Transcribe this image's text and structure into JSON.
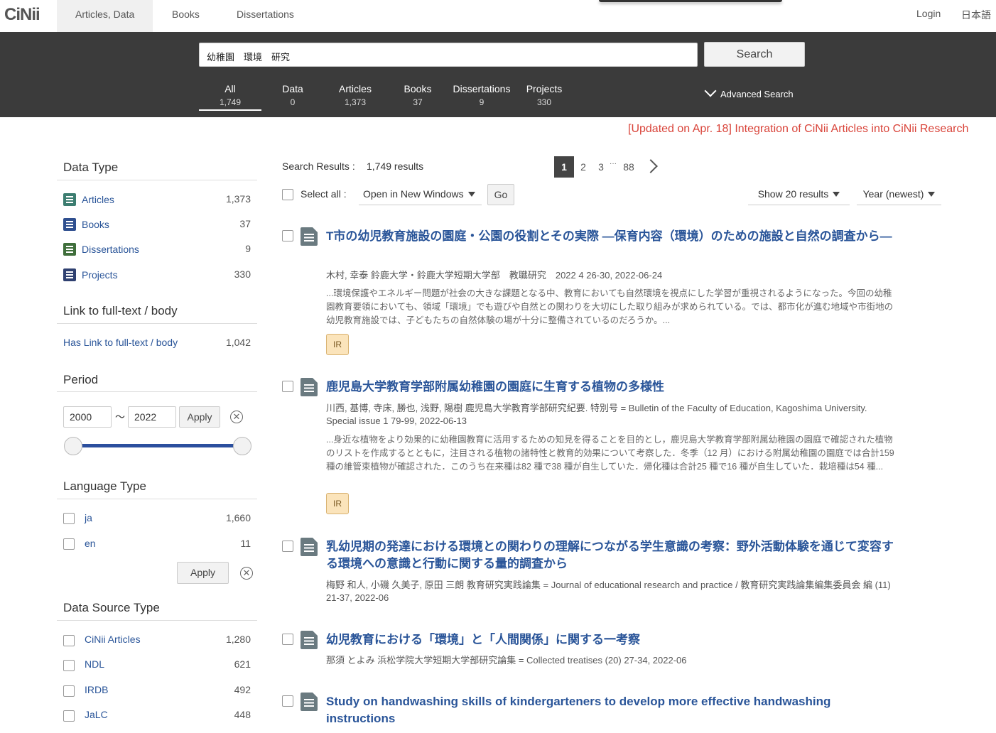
{
  "header": {
    "logo": "CiNii",
    "tabs": [
      "Articles, Data",
      "Books",
      "Dissertations"
    ],
    "login": "Login",
    "lang": "日本語"
  },
  "search": {
    "query": "幼稚園　環境　研究",
    "button": "Search",
    "advanced": "Advanced Search",
    "tabs": [
      {
        "label": "All",
        "count": "1,749"
      },
      {
        "label": "Data",
        "count": "0"
      },
      {
        "label": "Articles",
        "count": "1,373"
      },
      {
        "label": "Books",
        "count": "37"
      },
      {
        "label": "Dissertations",
        "count": "9"
      },
      {
        "label": "Projects",
        "count": "330"
      }
    ]
  },
  "notice": "[Updated on Apr. 18] Integration of CiNii Articles into CiNii Research",
  "sidebar": {
    "data_type": {
      "heading": "Data Type",
      "items": [
        {
          "label": "Articles",
          "count": "1,373",
          "icon": "article-icon"
        },
        {
          "label": "Books",
          "count": "37",
          "icon": "book-icon"
        },
        {
          "label": "Dissertations",
          "count": "9",
          "icon": "dissertation-icon"
        },
        {
          "label": "Projects",
          "count": "330",
          "icon": "project-icon"
        }
      ]
    },
    "fulltext": {
      "heading": "Link to full-text / body",
      "items": [
        {
          "label": "Has Link to full-text / body",
          "count": "1,042"
        }
      ]
    },
    "period": {
      "heading": "Period",
      "from": "2000",
      "tilde": "〜",
      "to": "2022",
      "apply": "Apply",
      "clear": "✕"
    },
    "language": {
      "heading": "Language Type",
      "items": [
        {
          "label": "ja",
          "count": "1,660"
        },
        {
          "label": "en",
          "count": "11"
        }
      ],
      "apply": "Apply",
      "clear": "✕"
    },
    "source": {
      "heading": "Data Source Type",
      "items": [
        {
          "label": "CiNii Articles",
          "count": "1,280"
        },
        {
          "label": "NDL",
          "count": "621"
        },
        {
          "label": "IRDB",
          "count": "492"
        },
        {
          "label": "JaLC",
          "count": "448"
        }
      ]
    }
  },
  "results": {
    "label": "Search Results :",
    "count": "1,749 results",
    "pages": [
      "1",
      "2",
      "3",
      "···",
      "88"
    ],
    "select_all": "Select all :",
    "open_mode": "Open in New Windows",
    "go": "Go",
    "show": "Show 20 results",
    "sort": "Year (newest)",
    "items": [
      {
        "title": "T市の幼児教育施設の園庭・公園の役割とその実際 ―保育内容（環境）のための施設と自然の調査から―",
        "meta": "木村, 幸泰 鈴鹿大学・鈴鹿大学短期大学部　教職研究　2022 4 26-30, 2022-06-24",
        "snippet": "...環境保護やエネルギー問題が社会の大きな課題となる中、教育においても自然環境を視点にした学習が重視されるようになった。今回の幼稚園教育要領においても、領域「環境」でも遊びや自然との関わりを大切にした取り組みが求められている。では、都市化が進む地域や市街地の幼児教育施設では、子どもたちの自然体験の場が十分に整備されているのだろうか。...",
        "badge": "IR"
      },
      {
        "title": "鹿児島大学教育学部附属幼稚園の園庭に生育する植物の多様性",
        "meta": "川西, 基博, 寺床, 勝也, 浅野, 陽樹 鹿児島大学教育学部研究紀要. 特別号 = Bulletin of the Faculty of Education, Kagoshima University. Special issue 1 79-99, 2022-06-13",
        "snippet": "...身近な植物をより効果的に幼稚園教育に活用するための知見を得ることを目的とし，鹿児島大学教育学部附属幼稚園の園庭で確認された植物のリストを作成するとともに，注目される植物の諸特性と教育的効果について考察した．冬季（12 月）における附属幼稚園の園庭では合計159 種の維管束植物が確認された．このうち在来種は82 種で38 種が自生していた．帰化種は合計25 種で16 種が自生していた．栽培種は54 種...",
        "badge": "IR"
      },
      {
        "title": "乳幼児期の発達における環境との関わりの理解につながる学生意識の考察：野外活動体験を通じて変容する環境への意識と行動に関する量的調査から",
        "meta": "梅野 和人, 小磯 久美子, 原田 三朗 教育研究実践論集 = Journal of educational research and practice / 教育研究実践論集編集委員会 編 (11) 21-37, 2022-06"
      },
      {
        "title": "幼児教育における「環境」と「人間関係」に関する一考察",
        "meta": "那須 とよみ 浜松学院大学短期大学部研究論集 = Collected treatises (20) 27-34, 2022-06"
      },
      {
        "title": "Study on handwashing skills of kindergarteners to develop more effective handwashing instructions"
      }
    ]
  }
}
